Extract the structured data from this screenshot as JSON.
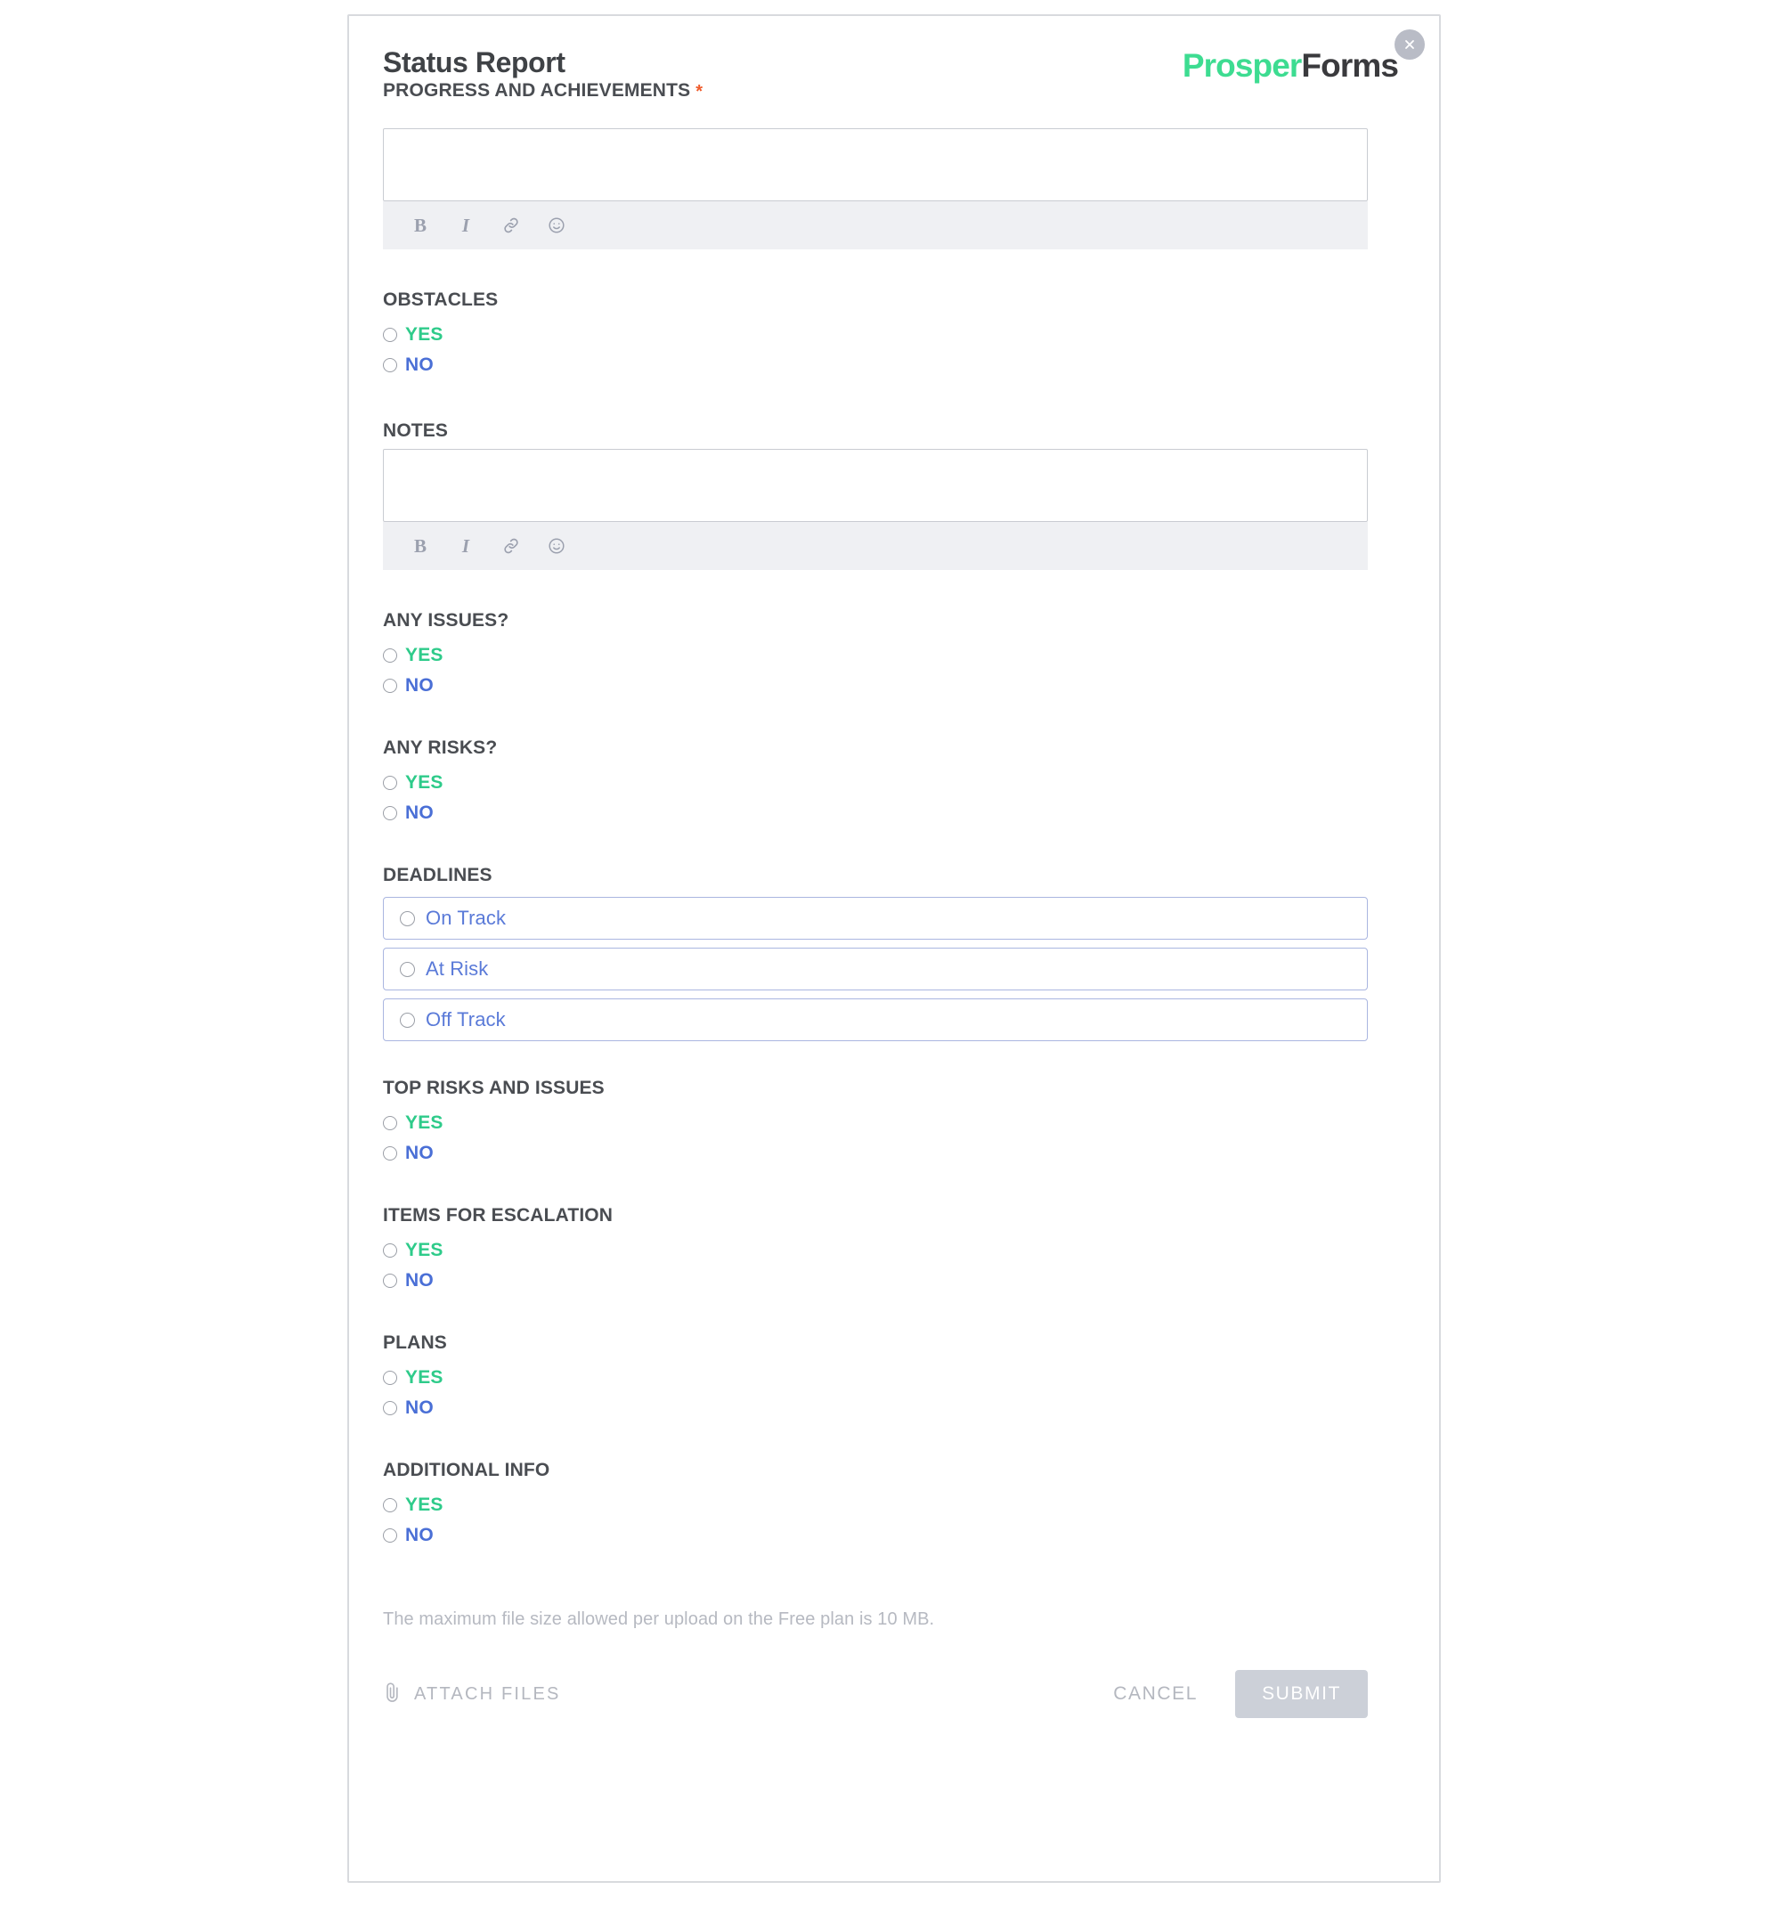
{
  "panel": {
    "title": "Status Report",
    "brand_first": "Prosper",
    "brand_second": "Forms",
    "close_icon": "close-icon"
  },
  "colors": {
    "brand_green": "#3ddc91",
    "brand_dark": "#3a3a3d",
    "yes_green": "#2ecb8a",
    "no_blue": "#4a6fd6",
    "choice_border": "#aab6e0",
    "required_star": "#ef5b2b",
    "submit_bg": "#ccd0d8",
    "muted_text": "#b4b7bf"
  },
  "editor_toolbar": {
    "bold": "B",
    "italic": "I",
    "link_icon": "link-icon",
    "emoji_icon": "emoji-icon"
  },
  "fields": {
    "progress": {
      "label": "PROGRESS AND ACHIEVEMENTS",
      "required": true,
      "required_marker": "*",
      "value": "",
      "placeholder": ""
    },
    "obstacles": {
      "label": "OBSTACLES",
      "options": [
        "YES",
        "NO"
      ],
      "selected": null
    },
    "notes": {
      "label": "NOTES",
      "required": false,
      "value": "",
      "placeholder": ""
    },
    "any_issues": {
      "label": "ANY ISSUES?",
      "options": [
        "YES",
        "NO"
      ],
      "selected": null
    },
    "any_risks": {
      "label": "ANY RISKS?",
      "options": [
        "YES",
        "NO"
      ],
      "selected": null
    },
    "deadlines": {
      "label": "DEADLINES",
      "options": [
        "On Track",
        "At Risk",
        "Off Track"
      ],
      "selected": null
    },
    "top_risks_and_issues": {
      "label": "TOP RISKS AND ISSUES",
      "options": [
        "YES",
        "NO"
      ],
      "selected": null
    },
    "items_for_escalation": {
      "label": "ITEMS FOR ESCALATION",
      "options": [
        "YES",
        "NO"
      ],
      "selected": null
    },
    "plans": {
      "label": "PLANS",
      "options": [
        "YES",
        "NO"
      ],
      "selected": null
    },
    "additional_info": {
      "label": "ADDITIONAL INFO",
      "options": [
        "YES",
        "NO"
      ],
      "selected": null
    }
  },
  "footer": {
    "file_size_note": "The maximum file size allowed per upload on the Free plan is 10 MB.",
    "attach_label": "ATTACH FILES",
    "attach_icon": "paperclip-icon",
    "cancel_label": "CANCEL",
    "submit_label": "SUBMIT",
    "submit_disabled": true
  }
}
